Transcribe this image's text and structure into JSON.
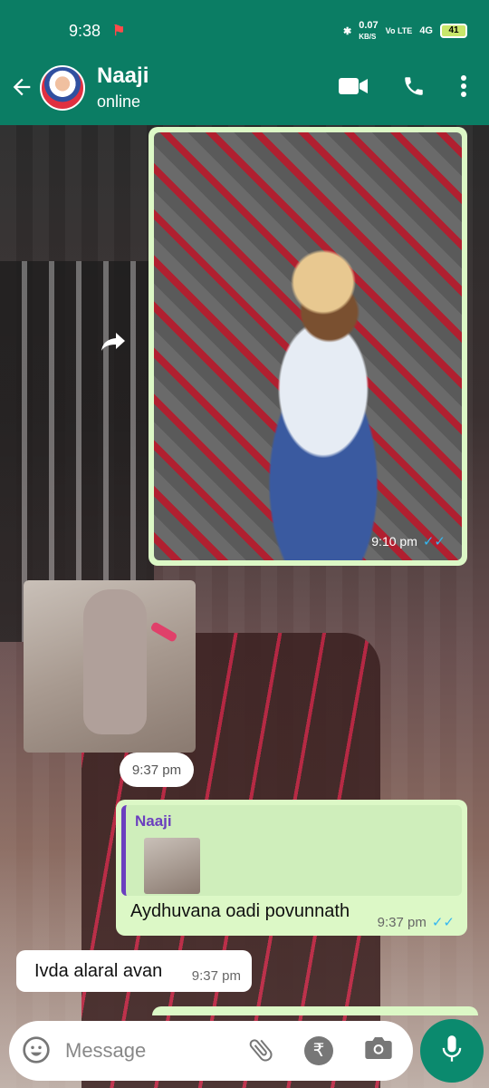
{
  "status_bar": {
    "time": "9:38",
    "network_speed": "0.07",
    "network_unit": "KB/S",
    "volte": "Vo LTE",
    "signal": "4G",
    "battery": "41"
  },
  "app_bar": {
    "back_icon": "arrow-left-icon",
    "contact_name": "Naaji",
    "contact_status": "online",
    "video_icon": "video-camera-icon",
    "call_icon": "phone-icon",
    "menu_icon": "more-vert-icon"
  },
  "messages": {
    "outgoing_image": {
      "timestamp": "9:10 pm",
      "ticks": "✓✓"
    },
    "incoming_image": {
      "timestamp": "9:37 pm"
    },
    "outgoing_reply": {
      "quoted_name": "Naaji",
      "text": "Aydhuvana oadi povunnath",
      "timestamp": "9:37 pm",
      "ticks": "✓✓"
    },
    "incoming_text": {
      "text": "Ivda alaral avan",
      "timestamp": "9:37 pm"
    }
  },
  "composer": {
    "placeholder": "Message",
    "emoji_icon": "emoji-icon",
    "attach_icon": "paperclip-icon",
    "payment_icon": "rupee-icon",
    "camera_icon": "camera-icon",
    "mic_icon": "microphone-icon"
  },
  "colors": {
    "header": "#0b7d64",
    "outgoing_bubble": "#dcf8c6",
    "ticks": "#34b7f1",
    "mic_button": "#0b8a6e"
  }
}
